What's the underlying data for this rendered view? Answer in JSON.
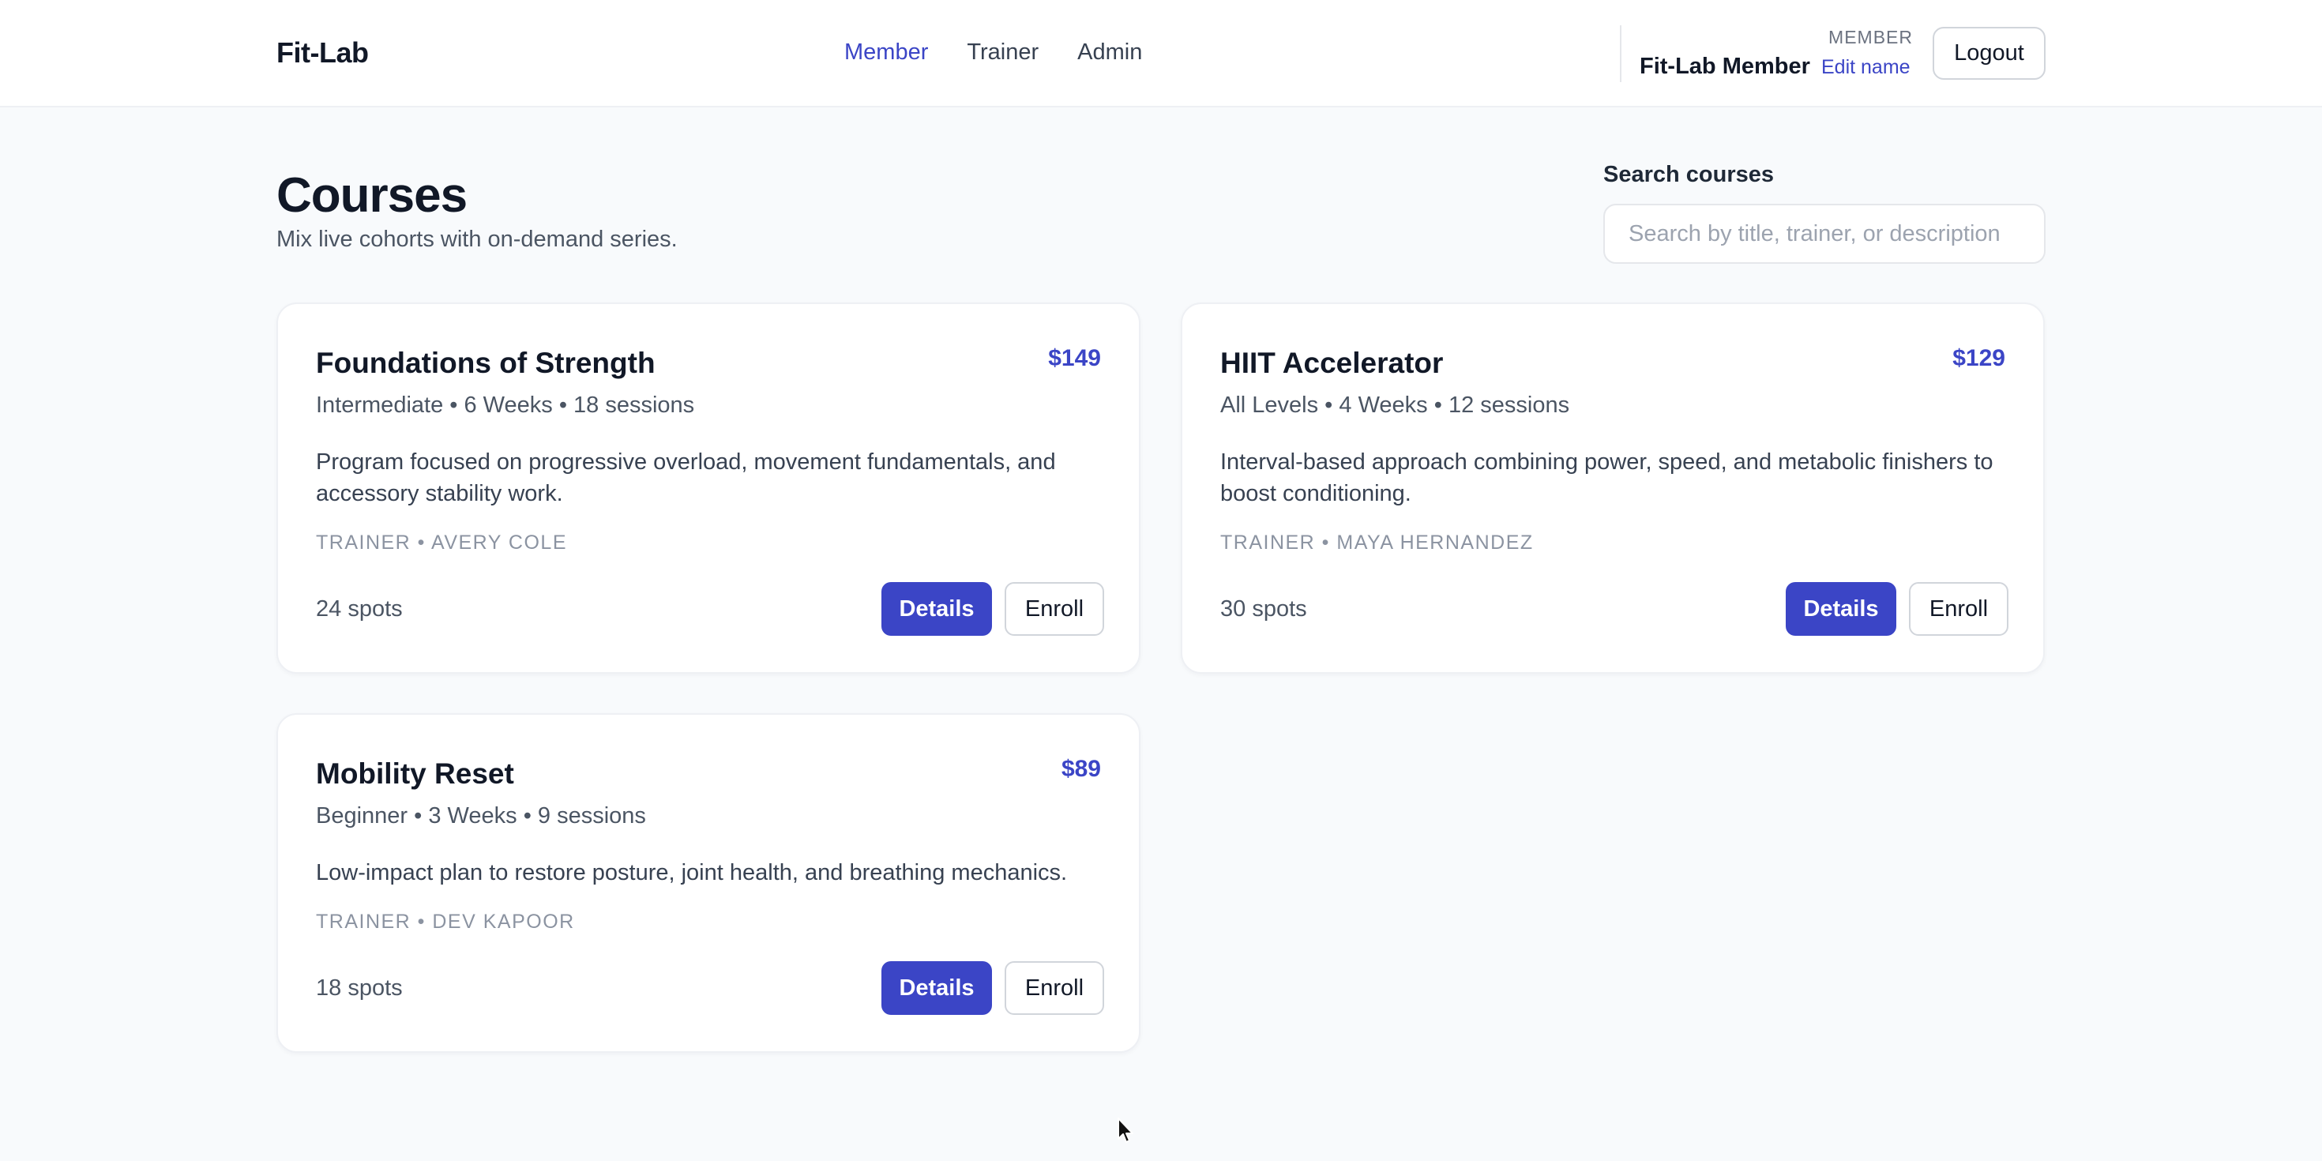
{
  "header": {
    "brand": "Fit-Lab",
    "nav": [
      {
        "label": "Member",
        "active": true
      },
      {
        "label": "Trainer",
        "active": false
      },
      {
        "label": "Admin",
        "active": false
      }
    ],
    "user_role": "MEMBER",
    "user_name": "Fit-Lab Member",
    "edit_name_label": "Edit name",
    "logout_label": "Logout"
  },
  "page": {
    "title": "Courses",
    "subtitle": "Mix live cohorts with on-demand series."
  },
  "search": {
    "label": "Search courses",
    "placeholder": "Search by title, trainer, or description",
    "value": ""
  },
  "courses": [
    {
      "title": "Foundations of Strength",
      "price": "$149",
      "meta": "Intermediate • 6 Weeks • 18 sessions",
      "description": "Program focused on progressive overload, movement fundamentals, and accessory stability work.",
      "trainer": "Trainer • Avery Cole",
      "spots": "24 spots",
      "details_label": "Details",
      "enroll_label": "Enroll"
    },
    {
      "title": "HIIT Accelerator",
      "price": "$129",
      "meta": "All Levels • 4 Weeks • 12 sessions",
      "description": "Interval-based approach combining power, speed, and metabolic finishers to boost conditioning.",
      "trainer": "Trainer • Maya Hernandez",
      "spots": "30 spots",
      "details_label": "Details",
      "enroll_label": "Enroll"
    },
    {
      "title": "Mobility Reset",
      "price": "$89",
      "meta": "Beginner • 3 Weeks • 9 sessions",
      "description": "Low-impact plan to restore posture, joint health, and breathing mechanics.",
      "trainer": "Trainer • Dev Kapoor",
      "spots": "18 spots",
      "details_label": "Details",
      "enroll_label": "Enroll"
    }
  ],
  "colors": {
    "accent": "#3b45c6",
    "background": "#f8fafc",
    "card": "#ffffff"
  },
  "icons": {
    "cursor": "mouse-pointer-icon"
  }
}
